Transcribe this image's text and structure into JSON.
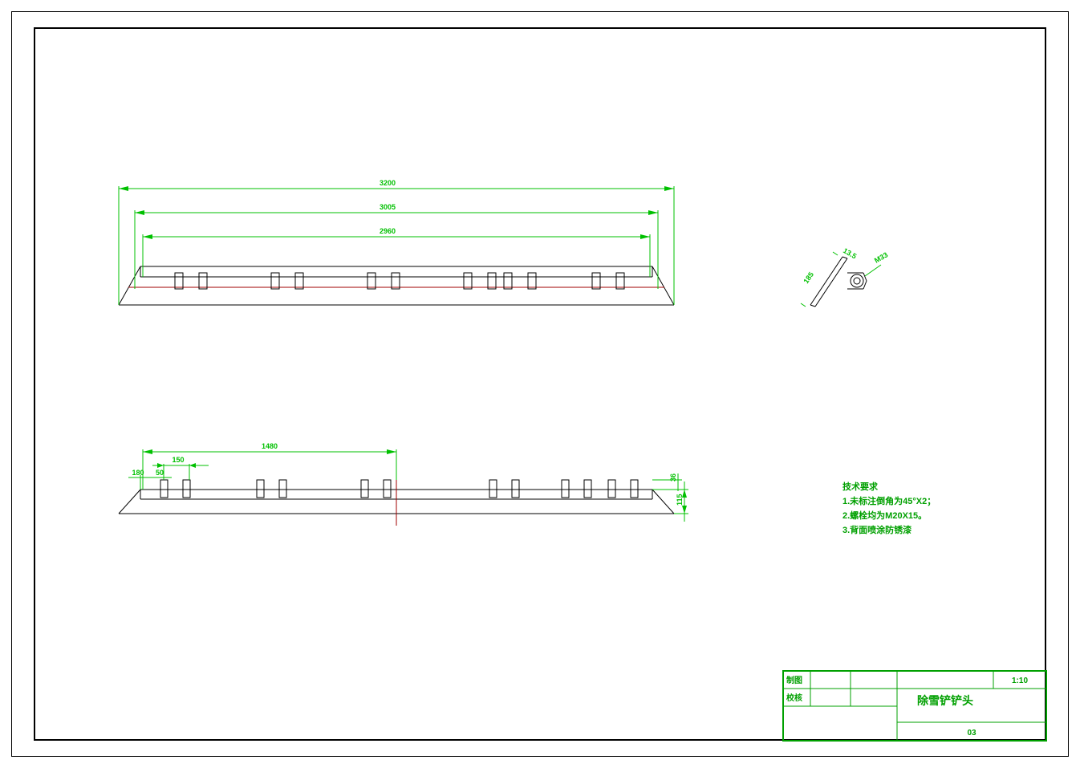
{
  "dims_top": {
    "d1": "3200",
    "d2": "3005",
    "d3": "2960"
  },
  "dims_bot": {
    "span": "1480",
    "d150": "150",
    "d180": "180",
    "d50": "50",
    "h115": "115",
    "h36": "36"
  },
  "side": {
    "d185": "185",
    "d13_5": "13.5",
    "m33": "M33"
  },
  "notes": {
    "title": "技术要求",
    "l1": "1.未标注倒角为45°X2；",
    "l2": "2.螺栓均为M20X15。",
    "l3": "3.背面喷涂防锈漆"
  },
  "tb": {
    "r1": "制图",
    "r2": "校核",
    "title": "除雪铲铲头",
    "scale": "1:10",
    "num": "03"
  }
}
